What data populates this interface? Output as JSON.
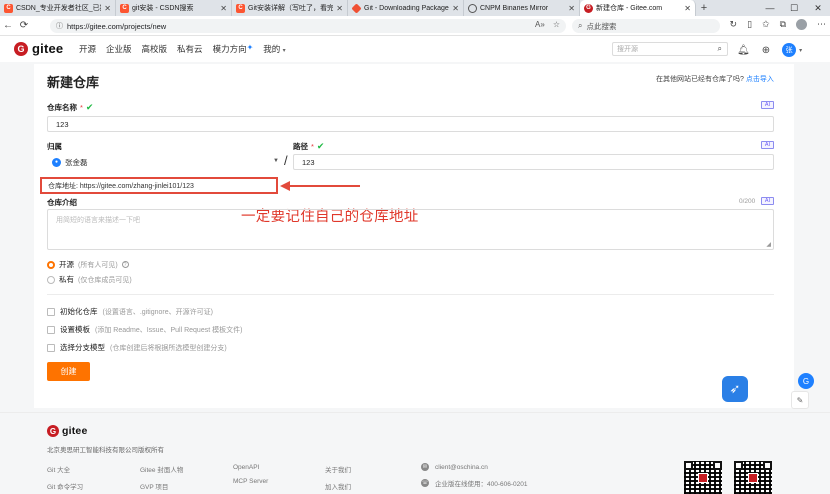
{
  "browser": {
    "tabs": [
      {
        "title": "CSDN_专业开发者社区_已接入Dee",
        "icon": "csdn-icon"
      },
      {
        "title": "git安装 - CSDN搜索",
        "icon": "csdn-icon"
      },
      {
        "title": "Git安装详解（写吐了，看完不赶紧",
        "icon": "csdn-icon"
      },
      {
        "title": "Git - Downloading Package",
        "icon": "git-icon"
      },
      {
        "title": "CNPM Binaries Mirror",
        "icon": "globe-icon"
      },
      {
        "title": "新建仓库 - Gitee.com",
        "icon": "gitee-icon",
        "active": true
      }
    ],
    "url": "https://gitee.com/projects/new",
    "search_placeholder": "点此搜索"
  },
  "header": {
    "logo_text": "gitee",
    "nav": [
      "开源",
      "企业版",
      "高校版",
      "私有云",
      "模力方向",
      "我的"
    ],
    "search_placeholder": "搜开源",
    "user_initial": "张"
  },
  "form": {
    "title": "新建仓库",
    "import_hint": "在其他网站已经有仓库了吗?",
    "import_link": "点击导入",
    "ai_label": "AI",
    "name_label": "仓库名称",
    "name_value": "123",
    "owner_label": "归属",
    "owner_value": "张金磊",
    "path_label": "路径",
    "path_value": "123",
    "repo_address": "仓库地址: https://gitee.com/zhang-jinlei101/123",
    "annotation": "一定要记住自己的仓库地址",
    "intro_label": "仓库介绍",
    "intro_counter": "0/200",
    "intro_placeholder": "用简短的语言来描述一下吧",
    "visibility": [
      {
        "label": "开源",
        "hint": "(所有人可见)",
        "checked": true
      },
      {
        "label": "私有",
        "hint": "(仅仓库成员可见)",
        "checked": false
      }
    ],
    "options": [
      {
        "label": "初始化仓库",
        "hint": "(设置语言、.gitignore、开源许可证)"
      },
      {
        "label": "设置模板",
        "hint": "(添加 Readme、Issue、Pull Request 模板文件)"
      },
      {
        "label": "选择分支模型",
        "hint": "(仓库创建后将根据所选模型创建分支)"
      }
    ],
    "create_label": "创建"
  },
  "footer": {
    "logo_text": "gitee",
    "company": "北京奥思研工智能科技有限公司版权所有",
    "col1": [
      "Git 大全",
      "Git 命令学习"
    ],
    "col2": [
      "Gitee 封面人物",
      "GVP 项目"
    ],
    "col3": [
      "OpenAPI",
      "MCP Server"
    ],
    "col4": [
      "关于我们",
      "加入我们"
    ],
    "email": "client@oschina.cn",
    "phone": "企业版在线使用：400-606-0201"
  },
  "colors": {
    "brand": "#c71d23",
    "accent": "#fe7300",
    "annotation": "#e0382b",
    "link": "#1e80ff"
  }
}
